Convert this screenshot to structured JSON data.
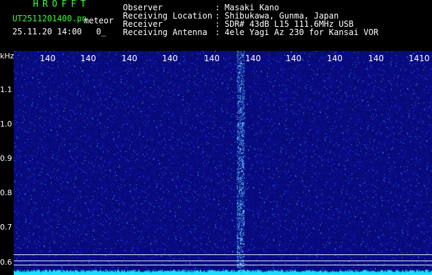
{
  "header": {
    "app_title": "HROFFT",
    "file_name": "UT2511201400.pn",
    "mode": "meteor",
    "datetime": "25.11.20 14:00",
    "status": "0_"
  },
  "info": [
    {
      "label": "Observer",
      "value": "Masaki Kano"
    },
    {
      "label": "Receiving Location",
      "value": "Shibukawa, Gunma, Japan"
    },
    {
      "label": "Receiver",
      "value": "SDR# 43dB L15 111.6MHz USB"
    },
    {
      "label": "Receiving Antenna",
      "value": "4ele Yagi Az 230 for Kansai VOR"
    }
  ],
  "info_colon": ":",
  "spectrogram": {
    "y_unit": "kHz",
    "y_ticks": [
      "1.1",
      "1.0",
      "0.9",
      "0.8",
      "0.7",
      "0.6"
    ],
    "x_ticks": [
      "140",
      "140",
      "140",
      "140",
      "140",
      "140",
      "140",
      "140",
      "140",
      "1410"
    ],
    "colors": {
      "background": "#0b0f7a",
      "signal": "#33d9ff",
      "trace": "#19e0ff"
    }
  }
}
